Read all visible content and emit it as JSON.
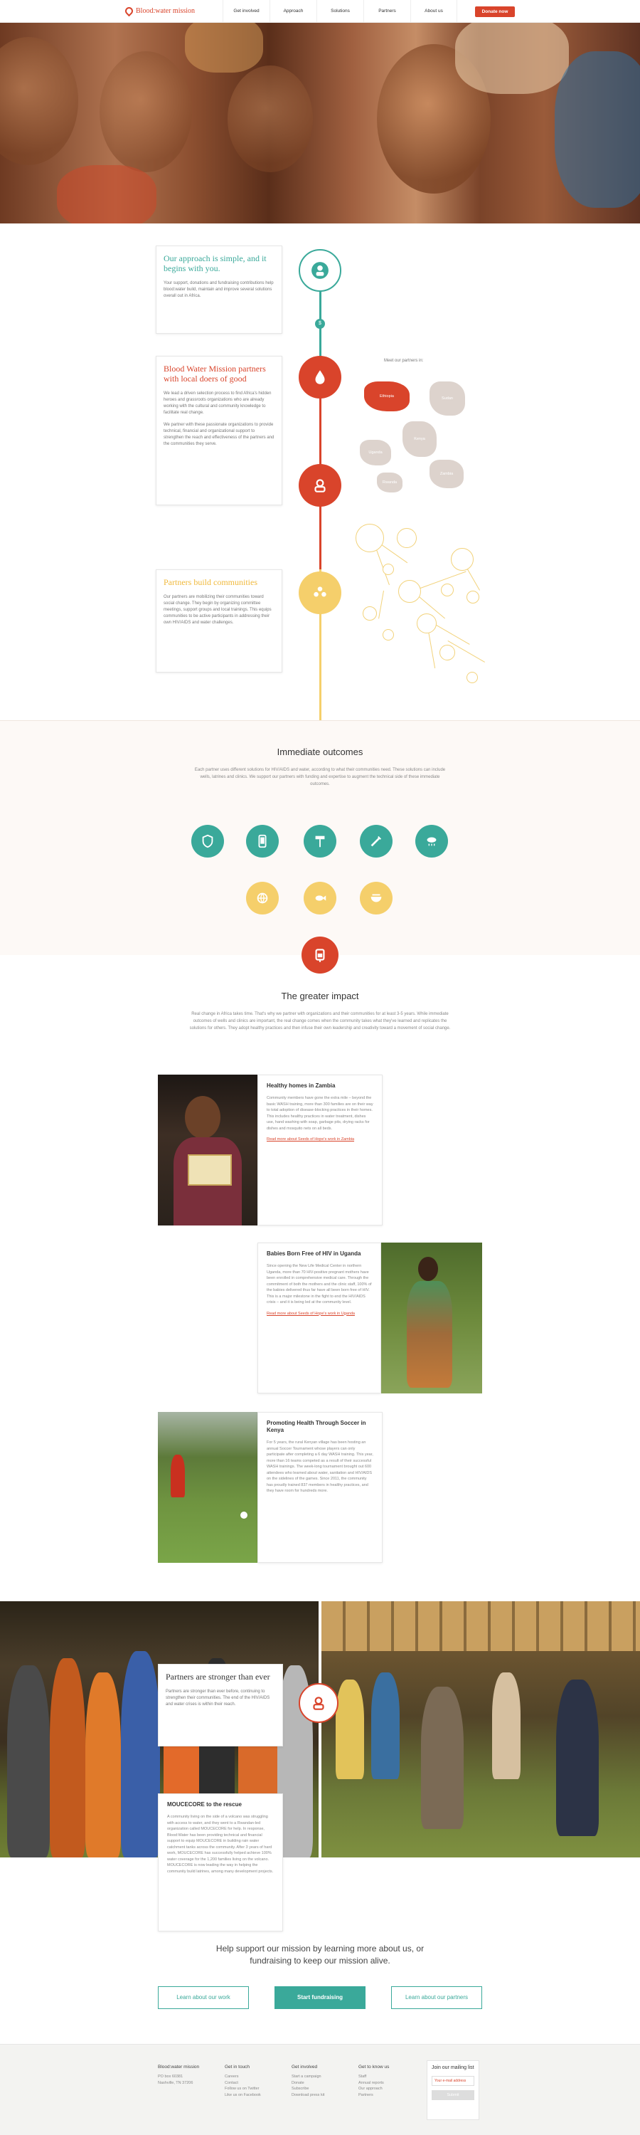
{
  "header": {
    "logo_text": "Blood:water mission",
    "nav": [
      "Get involved",
      "Approach",
      "Solutions",
      "Partners",
      "About us"
    ],
    "donate": "Donate now"
  },
  "colors": {
    "accent_teal": "#3aa99a",
    "accent_red": "#d9442b",
    "accent_yellow": "#f5cf6b"
  },
  "approach": {
    "card1": {
      "title": "Our approach is simple, and it begins with you.",
      "body": "Your support, donations and fundraising contributions help blood:water build, maintain and improve several solutions overall out in Africa."
    },
    "step_number": "$",
    "card2": {
      "title": "Blood Water Mission partners with local doers of good",
      "body1": "We lead a driven selection process to find Africa's hidden heroes and grassroots organizations who are already working with the cultural and community knowledge to facilitate real change.",
      "body2": "We partner with these passionate organizations to provide technical, financial and organizational support to strengthen the reach and effectiveness of the partners and the communities they serve."
    },
    "card3": {
      "title": "Partners build communities",
      "body": "Our partners are mobilizing their communities toward social change. They begin by organizing committee meetings, support groups and local trainings. This equips communities to be active participants in addressing their own HIV/AIDS and water challenges."
    },
    "map_label": "Meet our partners in:",
    "countries": [
      "Ethiopia",
      "Sudan",
      "Uganda",
      "Kenya",
      "Rwanda",
      "Zambia"
    ]
  },
  "outcomes": {
    "title": "Immediate outcomes",
    "desc": "Each partner uses different solutions for HIV/AIDS and water, according to what their communities need. These solutions can include wells, latrines and clinics. We support our partners with funding and expertise to augment the technical side of these immediate outcomes.",
    "icons_row1": [
      "shield-icon",
      "phone-icon",
      "hammer-icon",
      "syringe-icon",
      "rain-cloud-icon"
    ],
    "icons_row2": [
      "globe-icon",
      "fish-icon",
      "bowl-icon"
    ]
  },
  "impact": {
    "title": "The greater impact",
    "desc": "Real change in Africa takes time. That's why we partner with organizations and their communities for at least 3-5 years. While immediate outcomes of wells and clinics are important, the real change comes when the community takes what they've learned and replicates the solutions for others. They adopt healthy practices and then infuse their own leadership and creativity toward a movement of social change.",
    "stories": [
      {
        "title": "Healthy homes in Zambia",
        "body": "Community members have gone the extra mile – beyond the basic WASH training, more than 300 families are on their way to total adoption of disease-blocking practices in their homes. This includes healthy practices in water treatment, dishes use, hand washing with soap, garbage pits, drying racks for dishes and mosquito nets on all beds.",
        "link": "Read more about Seeds of Hope's work in Zambia"
      },
      {
        "title": "Babies Born Free of HIV in Uganda",
        "body": "Since opening the New Life Medical Center in northern Uganda, more than 70 HIV-positive pregnant mothers have been enrolled in comprehensive medical care. Through the commitment of both the mothers and the clinic staff, 100% of the babies delivered thus far have all been born free of HIV. This is a major milestone in the fight to end the HIV/AIDS crisis – and it is being led at the community level.",
        "link": "Read more about Seeds of Hope's work in Uganda"
      },
      {
        "title": "Promoting Health Through Soccer in Kenya",
        "body": "For 5 years, the rural Kenyan village has been hosting an annual Soccer Tournament whose players can only participate after completing a 6 day WASH training. This year, more than 16 teams competed as a result of their successful WASH trainings. The week-long tournament brought out 600 attendees who learned about water, sanitation and HIV/AIDS on the sidelines of the games. Since 2011, the community has proudly trained 837 members in healthy practices, and they have room for hundreds more.",
        "link": ""
      }
    ]
  },
  "stronger": {
    "title": "Partners are stronger than ever",
    "body": "Partners are stronger than ever before, continuing to strengthen their communities. The end of the HIV/AIDS and water crises is within their reach.",
    "sub_title": "MOUCECORE to the rescue",
    "sub_body": "A community living on the side of a volcano was struggling with access to water, and they went to a Rwandan-led organization called MOUCECORE for help. In response, Blood:Water has been providing technical and financial support to equip MOUCECORE in building rain water catchment tanks across the community. After 3 years of hard work, MOUCECORE has successfully helped achieve 100% water coverage for the 1,200 families living on the volcano. MOUCECORE is now leading the way in helping the community build latrines, among many development projects."
  },
  "cta": {
    "text": "Help support our mission by learning more about us, or fundraising to keep our mission alive.",
    "btn_learn": "Learn about our work",
    "btn_fund": "Start fundraising",
    "btn_partners": "Learn about our partners"
  },
  "footer": {
    "col1": {
      "title": "Blood:water mission",
      "lines": [
        "PO box 60381",
        "Nashville, TN 37206"
      ]
    },
    "col2": {
      "title": "Get in touch",
      "lines": [
        "Careers",
        "Contact",
        "Follow us on Twitter",
        "Like us on Facebook"
      ]
    },
    "col3": {
      "title": "Get involved",
      "lines": [
        "Start a campaign",
        "Donate",
        "Subscribe",
        "Download press kit"
      ]
    },
    "col4": {
      "title": "Get to know us",
      "lines": [
        "Staff",
        "Annual reports",
        "Our approach",
        "Partners"
      ]
    },
    "mailing": {
      "title": "Join our mailing list",
      "placeholder": "Your e-mail address",
      "submit": "Submit"
    }
  }
}
